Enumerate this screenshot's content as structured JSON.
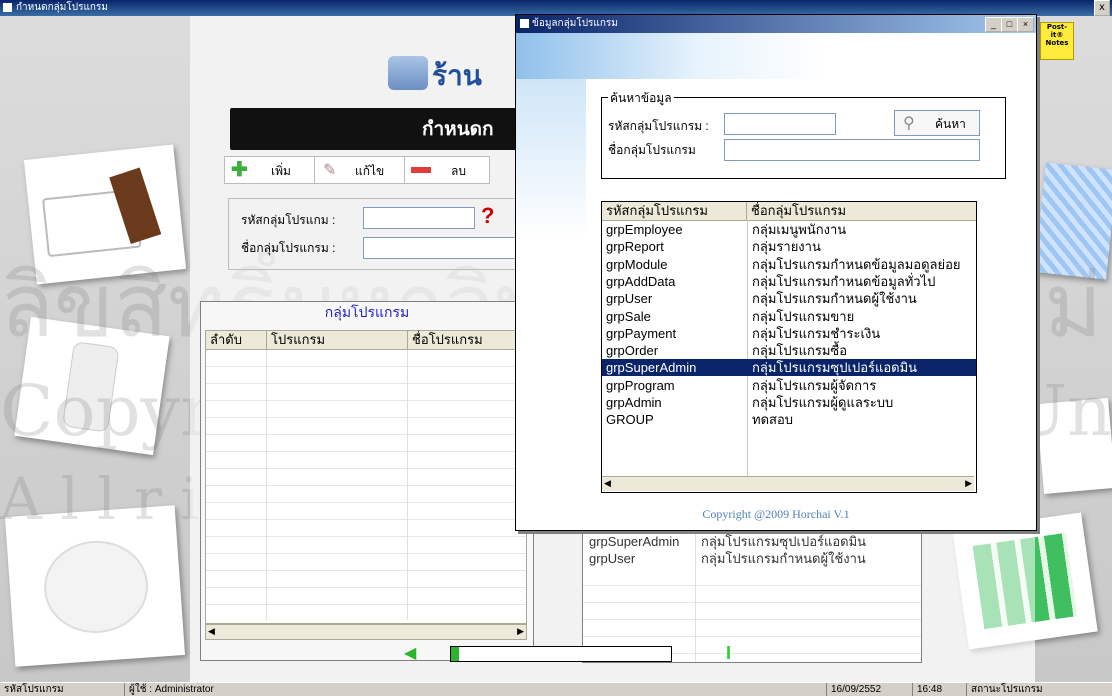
{
  "window": {
    "title": "กำหนดกลุ่มโปรแกรม",
    "close": "x"
  },
  "main": {
    "shop_title": "ร้าน",
    "banner": "กำหนดก",
    "toolbar": {
      "add": "เพิ่ม",
      "edit": "แก้ไข",
      "delete": "ลบ"
    },
    "form": {
      "code_label": "รหัสกลุ่มโปรแกม :",
      "name_label": "ชื่อกลุ่มโปรแกรม :",
      "code_value": "",
      "name_value": "",
      "help": "?"
    },
    "group_panel": {
      "title": "กลุ่มโปรแกรม",
      "columns": [
        "ลำดับ",
        "โปรแกรม",
        "ชื่อโปรแกรม"
      ]
    },
    "right_list": [
      {
        "code": "grpSuperAdmin",
        "name": "กลุ่มโปรแกรมซุปเปอร์แอดมิน"
      },
      {
        "code": "grpUser",
        "name": "กลุ่มโปรแกรมกำหนดผู้ใช้งาน"
      }
    ],
    "progress_icon": "I"
  },
  "postit": {
    "label": "Post-it® Notes"
  },
  "dialog": {
    "title": "ข้อมูลกลุ่มโปรแกรม",
    "search": {
      "group_label": "ค้นหาข้อมูล",
      "code_label": "รหัสกลุ่มโปรแกรม :",
      "name_label": "ชื่อกลุ่มโปรแกรม",
      "code_value": "",
      "name_value": "",
      "button": "ค้นหา"
    },
    "columns": [
      "รหัสกลุ่มโปรแกรม",
      "ชื่อกลุ่มโปรแกรม"
    ],
    "rows": [
      {
        "code": "grpEmployee",
        "name": "กลุ่มเมนูพนักงาน"
      },
      {
        "code": "grpReport",
        "name": "กลุ่มรายงาน"
      },
      {
        "code": "grpModule",
        "name": "กลุ่มโปรแกรมกำหนดข้อมูลมอดูลย่อย"
      },
      {
        "code": "grpAddData",
        "name": "กลุ่มโปรแกรมกำหนดข้อมูลทั่วไป"
      },
      {
        "code": "grpUser",
        "name": "กลุ่มโปรแกรมกำหนดผู้ใช้งาน"
      },
      {
        "code": "grpSale",
        "name": "กลุ่มโปรแกรมขาย"
      },
      {
        "code": "grpPayment",
        "name": "กลุ่มโปรแกรมชำระเงิน"
      },
      {
        "code": "grpOrder",
        "name": "กลุ่มโปรแกรมซื้อ"
      },
      {
        "code": "grpSuperAdmin",
        "name": "กลุ่มโปรแกรมซุปเปอร์แอดมิน"
      },
      {
        "code": "grpProgram",
        "name": "กลุ่มโปรแกรมผู้จัดการ"
      },
      {
        "code": "grpAdmin",
        "name": "กลุ่มโปรแกรมผู้ดูแลระบบ"
      },
      {
        "code": "GROUP",
        "name": "ทดสอบ"
      }
    ],
    "selected_index": 8,
    "copyright": "Copyright @2009 Horchai V.1"
  },
  "watermark": {
    "line1": "ลิขสิทธิ์มหาวิทยาลัยเชียงใหม่",
    "line2": "Copyright © by Chiang Mai University",
    "line3": "A l l r i g h t s r e s e r v e d"
  },
  "statusbar": {
    "left": "รหัสโปรแกรม",
    "user": "ผู้ใช้ : Administrator",
    "date": "16/09/2552",
    "time": "16:48",
    "status": "สถานะโปรแกรม"
  },
  "colors": {
    "titlebar": "#0a246a",
    "selected_row": "#0a246a",
    "link": "#0000cc",
    "copyright": "#4f81bd"
  }
}
